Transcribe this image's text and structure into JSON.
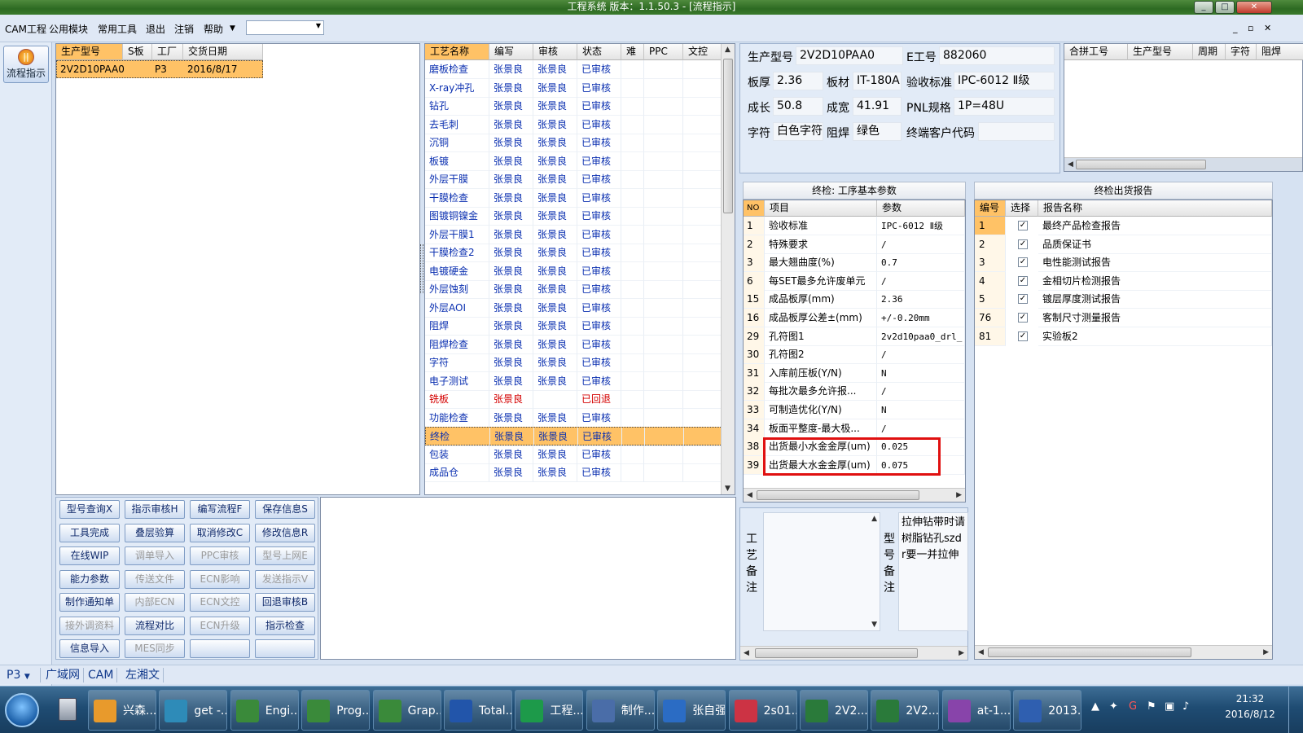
{
  "window": {
    "title": "工程系统   版本：1.1.50.3 - [流程指示]"
  },
  "menu": {
    "items": [
      "CAM工程",
      "公用模块",
      "常用工具",
      "退出",
      "注销",
      "帮助"
    ],
    "combo_value": ""
  },
  "sidebar": {
    "flow_button": "流程指示"
  },
  "orders": {
    "headers": [
      "生产型号",
      "S板",
      "工厂",
      "交货日期"
    ],
    "rows": [
      [
        "2V2D10PAA0",
        "",
        "P3",
        "2016/8/17"
      ]
    ]
  },
  "process": {
    "headers": [
      "工艺名称",
      "编写",
      "审核",
      "状态",
      "难",
      "PPC",
      "文控"
    ],
    "rows": [
      {
        "name": "磨板检查",
        "writer": "张景良",
        "reviewer": "张景良",
        "status": "已审核"
      },
      {
        "name": "X-ray冲孔",
        "writer": "张景良",
        "reviewer": "张景良",
        "status": "已审核"
      },
      {
        "name": "钻孔",
        "writer": "张景良",
        "reviewer": "张景良",
        "status": "已审核"
      },
      {
        "name": "去毛刺",
        "writer": "张景良",
        "reviewer": "张景良",
        "status": "已审核"
      },
      {
        "name": "沉铜",
        "writer": "张景良",
        "reviewer": "张景良",
        "status": "已审核"
      },
      {
        "name": "板镀",
        "writer": "张景良",
        "reviewer": "张景良",
        "status": "已审核"
      },
      {
        "name": "外层干膜",
        "writer": "张景良",
        "reviewer": "张景良",
        "status": "已审核"
      },
      {
        "name": "干膜检查",
        "writer": "张景良",
        "reviewer": "张景良",
        "status": "已审核"
      },
      {
        "name": "图镀铜镍金",
        "writer": "张景良",
        "reviewer": "张景良",
        "status": "已审核"
      },
      {
        "name": "外层干膜1",
        "writer": "张景良",
        "reviewer": "张景良",
        "status": "已审核"
      },
      {
        "name": "干膜检查2",
        "writer": "张景良",
        "reviewer": "张景良",
        "status": "已审核"
      },
      {
        "name": "电镀硬金",
        "writer": "张景良",
        "reviewer": "张景良",
        "status": "已审核"
      },
      {
        "name": "外层蚀刻",
        "writer": "张景良",
        "reviewer": "张景良",
        "status": "已审核"
      },
      {
        "name": "外层AOI",
        "writer": "张景良",
        "reviewer": "张景良",
        "status": "已审核"
      },
      {
        "name": "阻焊",
        "writer": "张景良",
        "reviewer": "张景良",
        "status": "已审核"
      },
      {
        "name": "阻焊检查",
        "writer": "张景良",
        "reviewer": "张景良",
        "status": "已审核"
      },
      {
        "name": "字符",
        "writer": "张景良",
        "reviewer": "张景良",
        "status": "已审核"
      },
      {
        "name": "电子测试",
        "writer": "张景良",
        "reviewer": "张景良",
        "status": "已审核"
      },
      {
        "name": "铣板",
        "writer": "张景良",
        "reviewer": "",
        "status": "已回退"
      },
      {
        "name": "功能检查",
        "writer": "张景良",
        "reviewer": "张景良",
        "status": "已审核"
      },
      {
        "name": "终检",
        "writer": "张景良",
        "reviewer": "张景良",
        "status": "已审核"
      },
      {
        "name": "包装",
        "writer": "张景良",
        "reviewer": "张景良",
        "status": "已审核"
      },
      {
        "name": "成品仓",
        "writer": "张景良",
        "reviewer": "张景良",
        "status": "已审核"
      }
    ]
  },
  "buttons": [
    {
      "label": "型号查询X",
      "enabled": true
    },
    {
      "label": "指示审核H",
      "enabled": true
    },
    {
      "label": "编写流程F",
      "enabled": true
    },
    {
      "label": "保存信息S",
      "enabled": true
    },
    {
      "label": "工具完成",
      "enabled": true
    },
    {
      "label": "叠层验算",
      "enabled": true
    },
    {
      "label": "取消修改C",
      "enabled": true
    },
    {
      "label": "修改信息R",
      "enabled": true
    },
    {
      "label": "在线WIP",
      "enabled": true
    },
    {
      "label": "调单导入",
      "enabled": false
    },
    {
      "label": "PPC审核",
      "enabled": false
    },
    {
      "label": "型号上网E",
      "enabled": false
    },
    {
      "label": "能力参数",
      "enabled": true
    },
    {
      "label": "传送文件",
      "enabled": false
    },
    {
      "label": "ECN影响",
      "enabled": false
    },
    {
      "label": "发送指示V",
      "enabled": false
    },
    {
      "label": "制作通知单",
      "enabled": true
    },
    {
      "label": "内部ECN",
      "enabled": false
    },
    {
      "label": "ECN文控",
      "enabled": false
    },
    {
      "label": "回退审核B",
      "enabled": true
    },
    {
      "label": "接外调资料",
      "enabled": false
    },
    {
      "label": "流程对比",
      "enabled": true
    },
    {
      "label": "ECN升级",
      "enabled": false
    },
    {
      "label": "指示检查",
      "enabled": true
    },
    {
      "label": "信息导入",
      "enabled": true
    },
    {
      "label": "MES同步",
      "enabled": false
    },
    {
      "label": "",
      "enabled": false
    },
    {
      "label": "",
      "enabled": false
    }
  ],
  "info": {
    "model_label": "生产型号",
    "model": "2V2D10PAA0",
    "eno_label": "E工号",
    "eno": "882060",
    "thickness_label": "板厚",
    "thickness": "2.36",
    "material_label": "板材",
    "material": "IT-180A",
    "standard_label": "验收标准",
    "standard": "IPC-6012 Ⅱ级",
    "length_label": "成长",
    "length": "50.8",
    "width_label": "成宽",
    "width": "41.91",
    "pnl_label": "PNL规格",
    "pnl": "1P=48U",
    "char_label": "字符",
    "char": "白色字符",
    "mask_label": "阻焊",
    "mask": "绿色",
    "customer_label": "终端客户代码",
    "customer": ""
  },
  "combined": {
    "headers": [
      "合拼工号",
      "生产型号",
      "周期",
      "字符",
      "阻焊"
    ],
    "rows": []
  },
  "params": {
    "title": "终检: 工序基本参数",
    "headers": [
      "NO",
      "项目",
      "参数"
    ],
    "rows": [
      [
        "1",
        "验收标准",
        "IPC-6012 Ⅱ级"
      ],
      [
        "2",
        "特殊要求",
        "/"
      ],
      [
        "3",
        "最大翘曲度(%)",
        "0.7"
      ],
      [
        "6",
        "每SET最多允许废单元",
        "/"
      ],
      [
        "15",
        "成品板厚(mm)",
        "2.36"
      ],
      [
        "16",
        "成品板厚公差±(mm)",
        "+/-0.20mm"
      ],
      [
        "29",
        "孔符图1",
        "2v2d10paa0_drl_"
      ],
      [
        "30",
        "孔符图2",
        "/"
      ],
      [
        "31",
        "入库前压板(Y/N)",
        "N"
      ],
      [
        "32",
        "每批次最多允许报...",
        "/"
      ],
      [
        "33",
        "可制造优化(Y/N)",
        "N"
      ],
      [
        "34",
        "板面平整度-最大极...",
        "/"
      ],
      [
        "38",
        "出货最小水金金厚(um)",
        "0.025"
      ],
      [
        "39",
        "出货最大水金金厚(um)",
        "0.075"
      ]
    ]
  },
  "reports": {
    "title": "终检出货报告",
    "headers": [
      "编号",
      "选择",
      "报告名称"
    ],
    "rows": [
      {
        "no": "1",
        "checked": "✓",
        "name": "最终产品检查报告"
      },
      {
        "no": "2",
        "checked": "✓",
        "name": "品质保证书"
      },
      {
        "no": "3",
        "checked": "✓",
        "name": "电性能测试报告"
      },
      {
        "no": "4",
        "checked": "✓",
        "name": "金相切片检测报告"
      },
      {
        "no": "5",
        "checked": "✓",
        "name": "镀层厚度测试报告"
      },
      {
        "no": "76",
        "checked": "✓",
        "name": "客制尺寸测量报告"
      },
      {
        "no": "81",
        "checked": "✓",
        "name": "实验板2"
      }
    ]
  },
  "notes": {
    "process_label": "工艺备注",
    "process_text": "",
    "model_label": "型号备注",
    "model_text": "拉伸钻带时请树脂钻孔szdr要一并拉伸"
  },
  "status": {
    "factory": "P3",
    "tabs": [
      "广域网",
      "CAM",
      "左湘文"
    ]
  },
  "taskbar": {
    "tasks": [
      "兴森...",
      "get -...",
      "Engi...",
      "Prog...",
      "Grap...",
      "Total...",
      "工程...",
      "制作...",
      "张自强",
      "2s01...",
      "2V2...",
      "2V2...",
      "at-1...",
      "2013..."
    ],
    "time": "21:32",
    "date": "2016/8/12"
  },
  "colors": {
    "highlight": "#ffc266",
    "accent_blue": "#0a2fb0",
    "returned_red": "#d40000",
    "callout": "#e01010"
  }
}
